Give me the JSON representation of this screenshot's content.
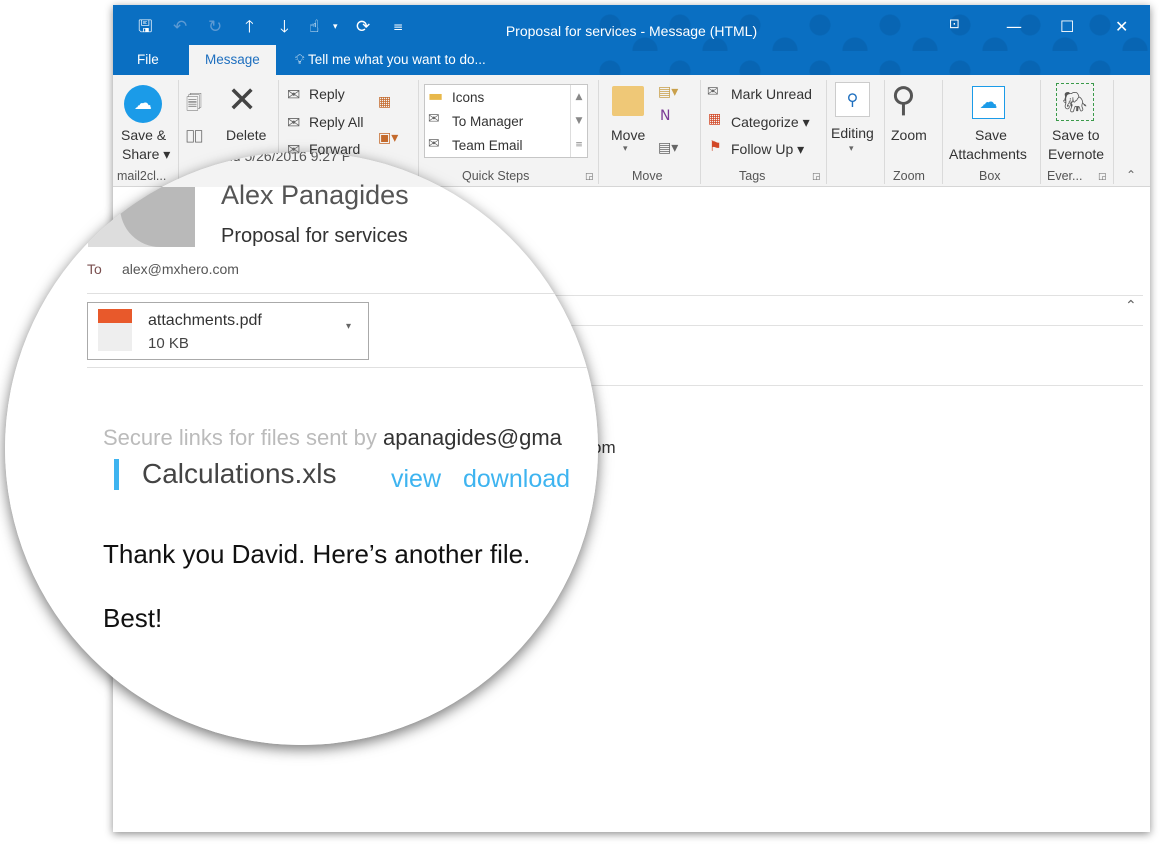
{
  "window": {
    "title": "Proposal for services - Message (HTML)",
    "accent": "#0a6fc2"
  },
  "tabs": {
    "file": "File",
    "message": "Message",
    "tell_me": "Tell me what you want to do..."
  },
  "ribbon": {
    "save_share": "Save &",
    "save_share2": "Share ▾",
    "mail2cloud_group": "mail2cl...",
    "delete": "Delete",
    "reply": "Reply",
    "reply_all": "Reply All",
    "forward": "Forward",
    "quick_steps": [
      "Icons",
      "To Manager",
      "Team Email"
    ],
    "quick_steps_group": "Quick Steps",
    "move": "Move",
    "move_group": "Move",
    "mark_unread": "Mark Unread",
    "categorize": "Categorize ▾",
    "follow_up": "Follow Up ▾",
    "tags_group": "Tags",
    "editing": "Editing",
    "zoom": "Zoom",
    "zoom_group": "Zoom",
    "save_attachments": "Save",
    "save_attachments2": "Attachments",
    "box_group": "Box",
    "save_evernote": "Save to",
    "save_evernote2": "Evernote",
    "evernote_group": "Ever..."
  },
  "message": {
    "date": "nd 5/26/2016 9:27 P",
    "sender": "Alex Panagides",
    "subject": "Proposal for services",
    "to_label": "To",
    "to": "alex@mxhero.com",
    "attachment": {
      "name": "attachments.pdf",
      "size": "10 KB"
    },
    "secure_prefix": "Secure links for files sent by ",
    "secure_sender": "apanagides@gma",
    "behind_tail": "om",
    "file": {
      "name": "Calculations.xls",
      "view": "view",
      "download": "download"
    },
    "body": [
      "Thank you David. Here’s another file.",
      "Best!"
    ]
  }
}
